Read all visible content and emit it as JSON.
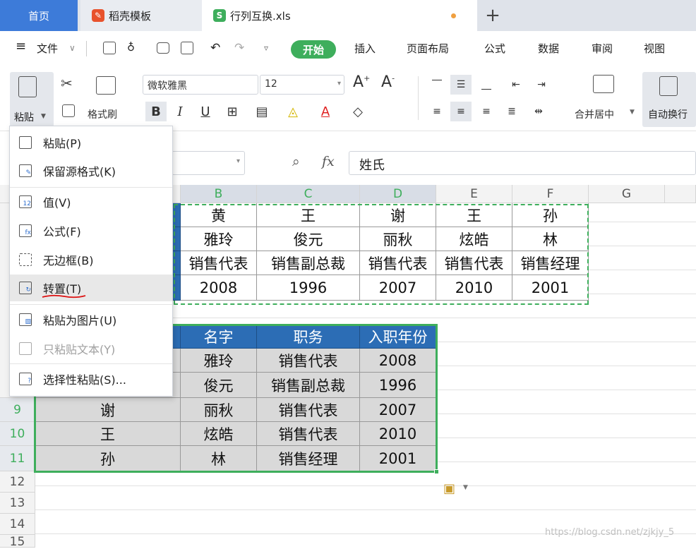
{
  "tabs": {
    "home": "首页",
    "template": "稻壳模板",
    "file": "行列互换.xls",
    "add": "+"
  },
  "menu": {
    "hamburger": "≡",
    "file": "文件",
    "start": "开始",
    "insert": "插入",
    "page_layout": "页面布局",
    "formula": "公式",
    "data": "数据",
    "review": "审阅",
    "view": "视图"
  },
  "toolbar": {
    "paste_label": "粘贴",
    "format_painter": "格式刷",
    "font_name": "微软雅黑",
    "font_size": "12",
    "bold": "B",
    "italic": "I",
    "underline": "U",
    "merge_center": "合并居中",
    "wrap": "自动换行"
  },
  "formula_bar": {
    "fx": "fx",
    "value": "姓氏"
  },
  "columns": [
    "B",
    "C",
    "D",
    "E",
    "F",
    "G"
  ],
  "rows": [
    "9",
    "10",
    "11",
    "12",
    "13",
    "14",
    "15"
  ],
  "transposed": {
    "surname": [
      "黄",
      "王",
      "谢",
      "王",
      "孙"
    ],
    "given": [
      "雅玲",
      "俊元",
      "丽秋",
      "炫皓",
      "林"
    ],
    "title": [
      "销售代表",
      "销售副总裁",
      "销售代表",
      "销售代表",
      "销售经理"
    ],
    "year": [
      "2008",
      "1996",
      "2007",
      "2010",
      "2001"
    ]
  },
  "table": {
    "headers": [
      "名字",
      "职务",
      "入职年份"
    ],
    "rows": [
      {
        "surname": "",
        "given": "雅玲",
        "title": "销售代表",
        "year": "2008"
      },
      {
        "surname": "",
        "given": "俊元",
        "title": "销售副总裁",
        "year": "1996"
      },
      {
        "surname": "谢",
        "given": "丽秋",
        "title": "销售代表",
        "year": "2007"
      },
      {
        "surname": "王",
        "given": "炫皓",
        "title": "销售代表",
        "year": "2010"
      },
      {
        "surname": "孙",
        "given": "林",
        "title": "销售经理",
        "year": "2001"
      }
    ]
  },
  "paste_menu": {
    "items": [
      "粘贴(P)",
      "保留源格式(K)",
      "值(V)",
      "公式(F)",
      "无边框(B)",
      "转置(T)",
      "粘贴为图片(U)",
      "只粘贴文本(Y)",
      "选择性粘贴(S)..."
    ]
  },
  "watermark": "https://blog.csdn.net/zjkjy_5",
  "colors": {
    "accent_green": "#3eae5c",
    "header_blue": "#2c6db5",
    "tab_blue": "#3d7bd9"
  }
}
